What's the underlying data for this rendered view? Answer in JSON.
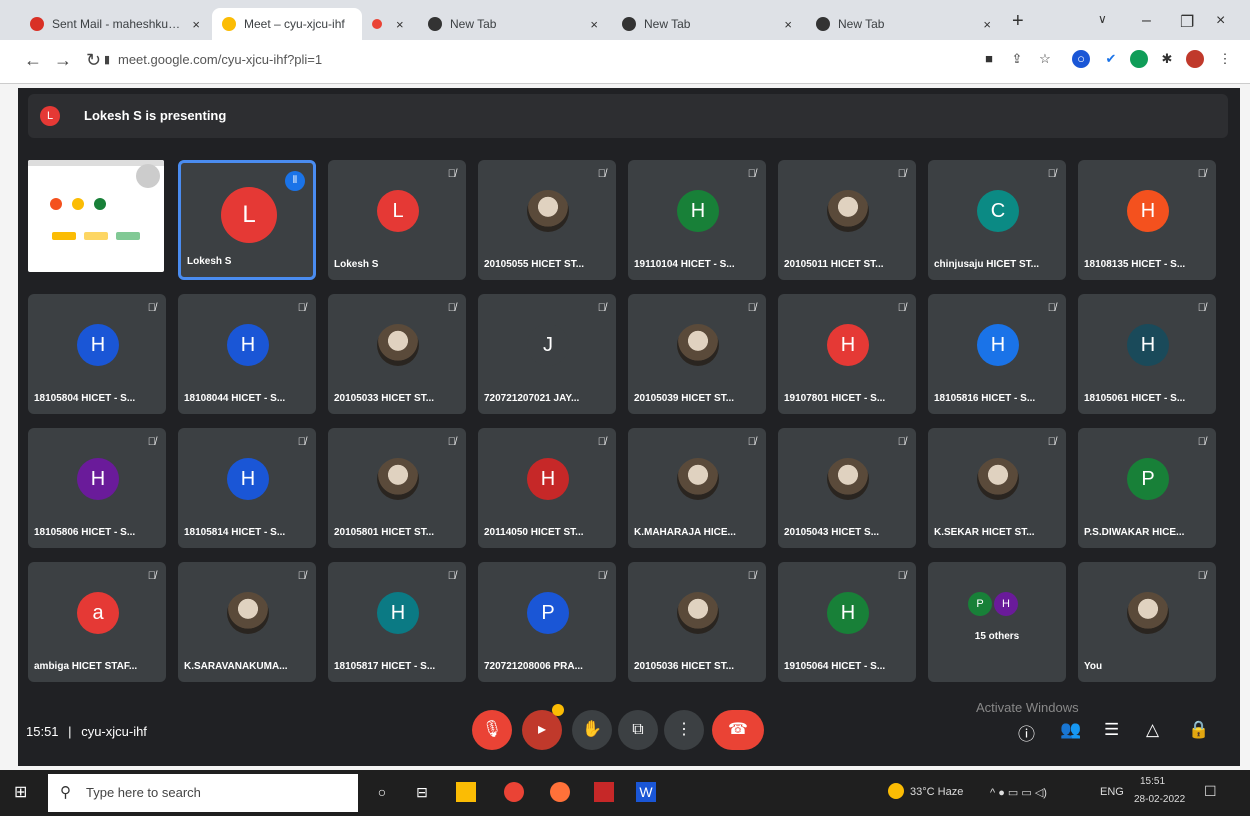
{
  "browser": {
    "tabs": [
      {
        "title": "Sent Mail - maheshkumar...",
        "favicon_color": "#d93025"
      },
      {
        "title": "Meet – cyu-xjcu-ihf",
        "favicon_color": "#fbbc04"
      },
      {
        "title": "",
        "favicon_color": "#ea4335"
      },
      {
        "title": "New Tab",
        "favicon_color": "#333333"
      },
      {
        "title": "New Tab",
        "favicon_color": "#333333"
      },
      {
        "title": "New Tab",
        "favicon_color": "#333333"
      }
    ],
    "new_tab": "+",
    "url": "meet.google.com/cyu-xjcu-ihf?pli=1"
  },
  "meet": {
    "presenting_initial": "L",
    "presenting_text": "Lokesh S is presenting",
    "participants": [
      {
        "name": "Lokesh S",
        "initial": "L",
        "color": "#e53935",
        "speaking": true
      },
      {
        "name": "Lokesh S",
        "initial": "L",
        "color": "#e53935"
      },
      {
        "name": "20105055 HICET ST...",
        "initial": "",
        "color": "#2d2e31",
        "photo": true
      },
      {
        "name": "19110104 HICET - S...",
        "initial": "H",
        "color": "#188038"
      },
      {
        "name": "20105011 HICET ST...",
        "initial": "",
        "color": "#2d2e31",
        "photo": true
      },
      {
        "name": "chinjusaju HICET ST...",
        "initial": "C",
        "color": "#0b8a84"
      },
      {
        "name": "18108135 HICET - S...",
        "initial": "H",
        "color": "#f4511e"
      },
      {
        "name": "18105804 HICET - S...",
        "initial": "H",
        "color": "#1a56d6"
      },
      {
        "name": "18108044 HICET - S...",
        "initial": "H",
        "color": "#1a56d6"
      },
      {
        "name": "20105033 HICET ST...",
        "initial": "",
        "color": "#2d2e31",
        "photo": true
      },
      {
        "name": "720721207021 JAY...",
        "initial": "J",
        "color": "#3c4043"
      },
      {
        "name": "20105039 HICET ST...",
        "initial": "",
        "color": "#2d2e31",
        "photo": true
      },
      {
        "name": "19107801 HICET - S...",
        "initial": "H",
        "color": "#e53935"
      },
      {
        "name": "18105816 HICET - S...",
        "initial": "H",
        "color": "#1a73e8"
      },
      {
        "name": "18105061 HICET - S...",
        "initial": "H",
        "color": "#1a4a5a"
      },
      {
        "name": "18105806 HICET - S...",
        "initial": "H",
        "color": "#6a1b9a"
      },
      {
        "name": "18105814 HICET - S...",
        "initial": "H",
        "color": "#1a56d6"
      },
      {
        "name": "20105801 HICET ST...",
        "initial": "",
        "color": "#2d2e31",
        "photo": true
      },
      {
        "name": "20114050 HICET ST...",
        "initial": "H",
        "color": "#c62828"
      },
      {
        "name": "K.MAHARAJA HICE...",
        "initial": "",
        "color": "#2d2e31",
        "photo": true
      },
      {
        "name": "20105043 HICET S...",
        "initial": "",
        "color": "#2d2e31",
        "photo": true
      },
      {
        "name": "K.SEKAR HICET ST...",
        "initial": "",
        "color": "#2d2e31",
        "photo": true
      },
      {
        "name": "P.S.DIWAKAR HICE...",
        "initial": "P",
        "color": "#188038"
      },
      {
        "name": "ambiga HICET STAF...",
        "initial": "a",
        "color": "#e53935"
      },
      {
        "name": "K.SARAVANAKUMA...",
        "initial": "",
        "color": "#2d2e31",
        "photo": true
      },
      {
        "name": "18105817 HICET - S...",
        "initial": "H",
        "color": "#0b7a84"
      },
      {
        "name": "720721208006 PRA...",
        "initial": "P",
        "color": "#1a56d6"
      },
      {
        "name": "20105036 HICET ST...",
        "initial": "",
        "color": "#2d2e31",
        "photo": true
      },
      {
        "name": "19105064 HICET - S...",
        "initial": "H",
        "color": "#188038"
      },
      {
        "name": "15 others",
        "initial": "P",
        "color": "#188038",
        "others": true
      },
      {
        "name": "You",
        "initial": "",
        "color": "#2d2e31",
        "photo": true
      }
    ],
    "others_second_initial": "H",
    "time": "15:51",
    "separator": "|",
    "meeting_code": "cyu-xjcu-ihf",
    "watermark": "Activate Windows",
    "controls": {
      "hand_icon": "✋",
      "present_icon": "⧉",
      "more_icon": "⋮",
      "info_icon": "ⓘ",
      "people_icon": "👥",
      "chat_icon": "☰",
      "activities_icon": "△",
      "lock_icon": "🔒"
    }
  },
  "taskbar": {
    "search_placeholder": "Type here to search",
    "weather": "33°C Haze",
    "lang": "ENG",
    "clock_time": "15:51",
    "clock_date": "28-02-2022"
  }
}
